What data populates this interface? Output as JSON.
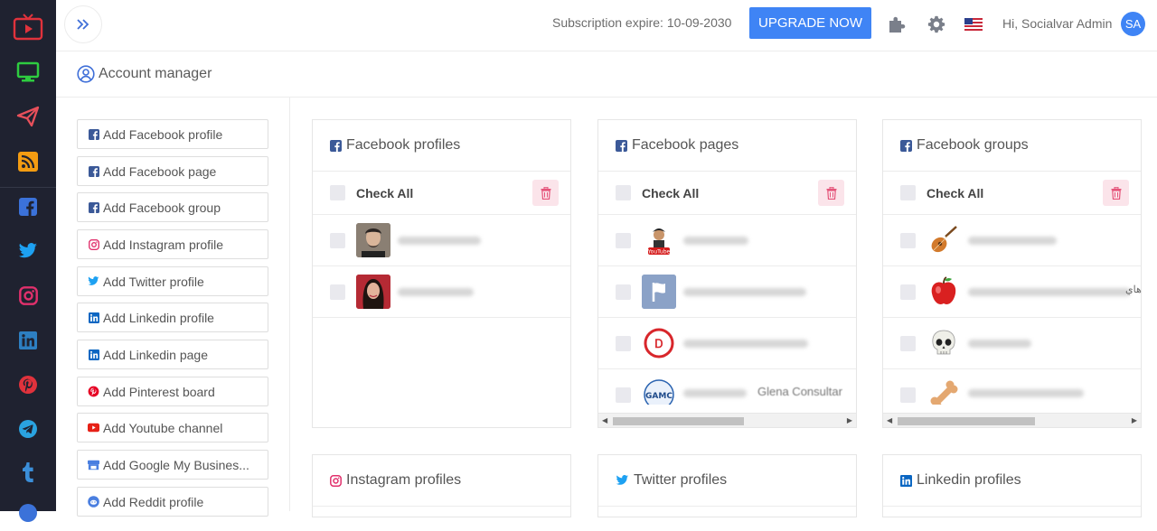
{
  "header": {
    "subscription_text": "Subscription expire: 10-09-2030",
    "upgrade_label": "UPGRADE NOW",
    "greeting": "Hi, Socialvar Admin",
    "avatar_initials": "SA"
  },
  "subheader": {
    "title": "Account manager"
  },
  "rail": {
    "items": [
      {
        "icon": "youtube-tv-icon",
        "color": "#e0323c"
      },
      {
        "icon": "monitor-icon",
        "color": "#2ecc40"
      },
      {
        "icon": "send-icon",
        "color": "#e8505b"
      },
      {
        "icon": "rss-icon",
        "color": "#f39c12"
      },
      {
        "icon": "facebook-icon",
        "color": "#3b72d9"
      },
      {
        "icon": "twitter-icon",
        "color": "#1da1f2"
      },
      {
        "icon": "instagram-icon",
        "color": "#e1306c"
      },
      {
        "icon": "linkedin-icon",
        "color": "#2d7fc1"
      },
      {
        "icon": "pinterest-icon",
        "color": "#e0323c"
      },
      {
        "icon": "telegram-icon",
        "color": "#2aa3e0"
      },
      {
        "icon": "tumblr-icon",
        "color": "#3b8fd9"
      }
    ]
  },
  "add_buttons": [
    {
      "label": "Add Facebook profile",
      "icon": "facebook-icon",
      "color": "#3b5998"
    },
    {
      "label": "Add Facebook page",
      "icon": "facebook-icon",
      "color": "#3b5998"
    },
    {
      "label": "Add Facebook group",
      "icon": "facebook-icon",
      "color": "#3b5998"
    },
    {
      "label": "Add Instagram profile",
      "icon": "instagram-icon",
      "color": "#e1306c"
    },
    {
      "label": "Add Twitter profile",
      "icon": "twitter-icon",
      "color": "#1da1f2"
    },
    {
      "label": "Add Linkedin profile",
      "icon": "linkedin-icon",
      "color": "#0a66c2"
    },
    {
      "label": "Add Linkedin page",
      "icon": "linkedin-icon",
      "color": "#0a66c2"
    },
    {
      "label": "Add Pinterest board",
      "icon": "pinterest-icon",
      "color": "#e60023"
    },
    {
      "label": "Add Youtube channel",
      "icon": "youtube-icon",
      "color": "#e62117"
    },
    {
      "label": "Add Google My Busines...",
      "icon": "google-business-icon",
      "color": "#4a7fe0"
    },
    {
      "label": "Add Reddit profile",
      "icon": "reddit-icon",
      "color": "#4a7fe0"
    }
  ],
  "cards": {
    "fb_profiles": {
      "title": "Facebook profiles",
      "check_all": "Check All"
    },
    "fb_pages": {
      "title": "Facebook pages",
      "check_all": "Check All"
    },
    "fb_groups": {
      "title": "Facebook groups",
      "check_all": "Check All"
    },
    "ig_profiles": {
      "title": "Instagram profiles"
    },
    "tw_profiles": {
      "title": "Twitter profiles"
    },
    "li_profiles": {
      "title": "Linkedin profiles"
    }
  },
  "page_row_texts": {
    "gamc_suffix": "Glena Consultar",
    "apple_suffix": "هاي"
  }
}
